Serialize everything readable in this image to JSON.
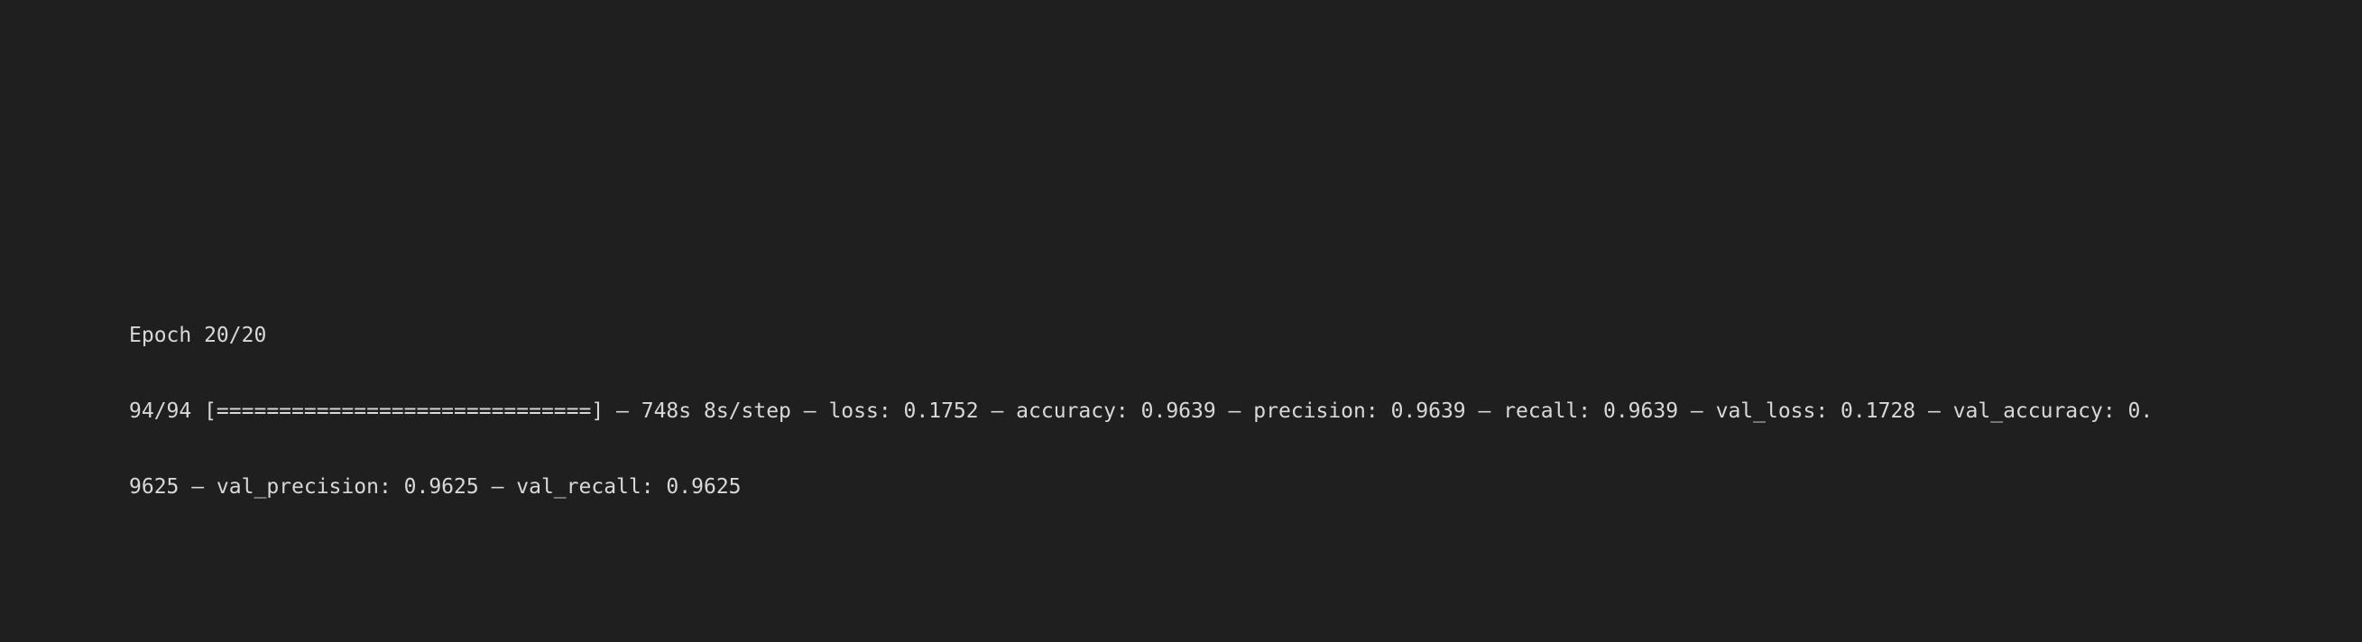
{
  "terminal": {
    "lines": [
      "Epoch 20/20",
      "94/94 [==============================] – 748s 8s/step – loss: 0.1752 – accuracy: 0.9639 – precision: 0.9639 – recall: 0.9639 – val_loss: 0.1728 – val_accuracy: 0.",
      "9625 – val_precision: 0.9625 – val_recall: 0.9625"
    ]
  }
}
